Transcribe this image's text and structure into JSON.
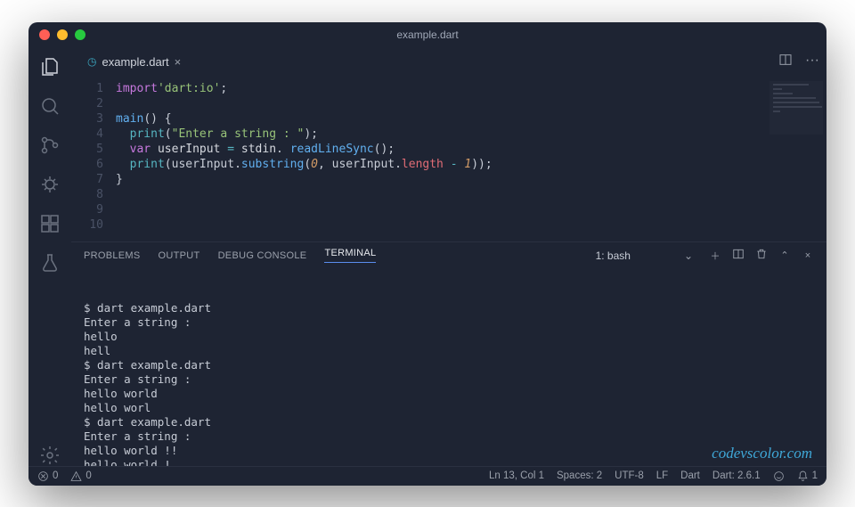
{
  "window": {
    "title": "example.dart"
  },
  "tab": {
    "filename": "example.dart"
  },
  "activity_icons": [
    "files",
    "search",
    "git",
    "debug",
    "extensions",
    "test",
    "settings"
  ],
  "code": {
    "line_numbers": [
      "1",
      "2",
      "3",
      "4",
      "5",
      "6",
      "7",
      "8",
      "9",
      "10"
    ],
    "tokens": [
      [
        [
          "kw",
          "import"
        ],
        [
          "",
          ""
        ],
        [
          "str",
          "'dart:io'"
        ],
        [
          "",
          ";"
        ]
      ],
      [],
      [
        [
          "fn",
          "main"
        ],
        [
          "",
          "() {"
        ]
      ],
      [
        [
          "",
          "  "
        ],
        [
          "pt",
          "print"
        ],
        [
          "",
          "("
        ],
        [
          "str",
          "\"Enter a string : \""
        ],
        [
          "",
          ");"
        ]
      ],
      [
        [
          "",
          "  "
        ],
        [
          "kw",
          "var"
        ],
        [
          "id",
          " userInput"
        ],
        [
          "op",
          " = "
        ],
        [
          "id",
          "stdin"
        ],
        [
          "",
          ". "
        ],
        [
          "fn",
          "readLineSync"
        ],
        [
          "",
          "();"
        ]
      ],
      [
        [
          "",
          "  "
        ],
        [
          "pt",
          "print"
        ],
        [
          "",
          "(userInput."
        ],
        [
          "fn",
          "substring"
        ],
        [
          "",
          "("
        ],
        [
          "nm",
          "0"
        ],
        [
          "",
          ", userInput."
        ],
        [
          "prop",
          "length"
        ],
        [
          "op",
          " - "
        ],
        [
          "nm",
          "1"
        ],
        [
          "",
          "));"
        ]
      ],
      [
        [
          "",
          "}"
        ]
      ],
      [],
      [],
      []
    ]
  },
  "panel": {
    "tabs": {
      "problems": "PROBLEMS",
      "output": "OUTPUT",
      "debug": "DEBUG CONSOLE",
      "terminal": "TERMINAL"
    },
    "terminal_select": "1: bash",
    "terminal_lines": [
      "$ dart example.dart",
      "Enter a string :",
      "hello",
      "hell",
      "$ dart example.dart",
      "Enter a string :",
      "hello world",
      "hello worl",
      "$ dart example.dart",
      "Enter a string :",
      "hello world !!",
      "hello world !",
      "$ "
    ]
  },
  "status": {
    "errors": "0",
    "warnings": "0",
    "cursor": "Ln 13, Col 1",
    "spaces": "Spaces: 2",
    "encoding": "UTF-8",
    "eol": "LF",
    "lang": "Dart",
    "dart_ver": "Dart: 2.6.1",
    "notifications": "1"
  },
  "watermark": "codevscolor.com"
}
